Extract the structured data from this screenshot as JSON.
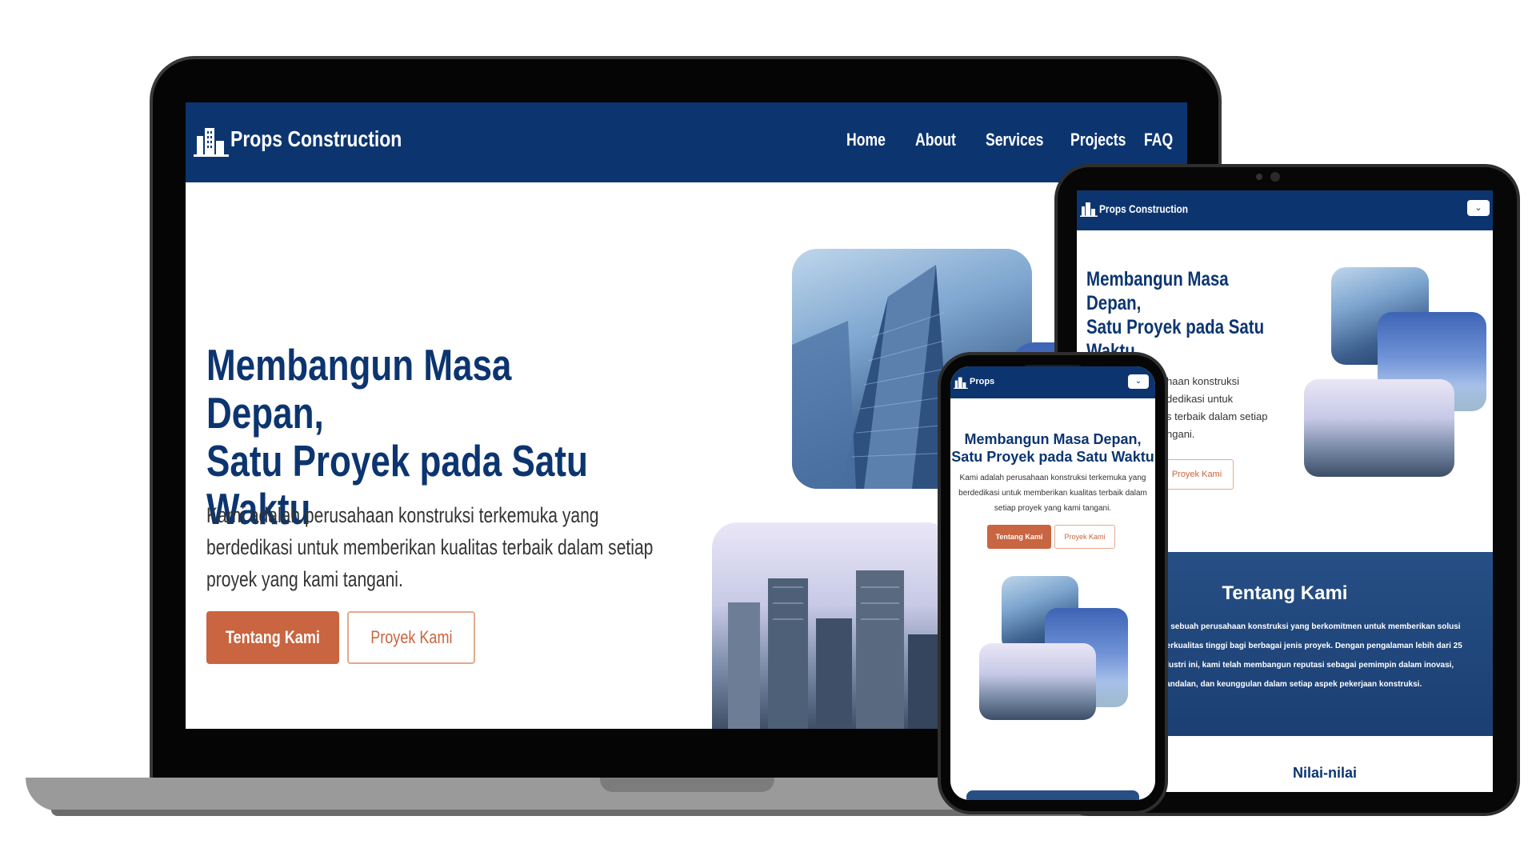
{
  "brand": {
    "name": "Props Construction"
  },
  "nav": {
    "items": [
      "Home",
      "About",
      "Services",
      "Projects",
      "FAQ"
    ]
  },
  "hero": {
    "title_line1": "Membangun Masa Depan,",
    "title_line2": "Satu Proyek pada Satu",
    "title_line3": "Waktu",
    "description": "Kami adalah perusahaan konstruksi terkemuka yang berdedikasi untuk memberikan kualitas terbaik dalam setiap proyek yang kami tangani.",
    "primary_button": "Tentang Kami",
    "secondary_button": "Proyek Kami"
  },
  "tablet": {
    "title_line1": "Membangun Masa",
    "title_line2": "Depan,",
    "title_line3": "Satu Proyek pada Satu",
    "title_line4": "Waktu",
    "desc_fragments": [
      "haan konstruksi",
      "dedikasi untuk",
      "s terbaik dalam setiap",
      "ngani."
    ],
    "button_fragment": "Proyek Kami",
    "about_title": "Tentang Kami",
    "about_lines": [
      "lah sebuah perusahaan konstruksi yang berkomitmen untuk memberikan solusi",
      "i berkualitas tinggi bagi berbagai jenis proyek. Dengan pengalaman lebih dari 25",
      "industri ini, kami telah membangun reputasi sebagai pemimpin dalam inovasi,",
      "keandalan, dan keunggulan dalam setiap aspek pekerjaan konstruksi."
    ],
    "values_title": "Nilai-nilai"
  },
  "phone": {
    "brand_fragment": "Props",
    "title_line1": "Membangun Masa Depan,",
    "title_line2": "Satu Proyek pada Satu Waktu",
    "description": "Kami adalah perusahaan konstruksi terkemuka yang berdedikasi untuk memberikan kualitas terbaik dalam setiap proyek yang kami tangani.",
    "primary_button": "Tentang Kami",
    "secondary_button": "Proyek Kami"
  },
  "colors": {
    "navy": "#0c3570",
    "accent": "#c96540"
  },
  "icons": {
    "logo": "building-icon",
    "menu": "chevron-down-icon"
  }
}
